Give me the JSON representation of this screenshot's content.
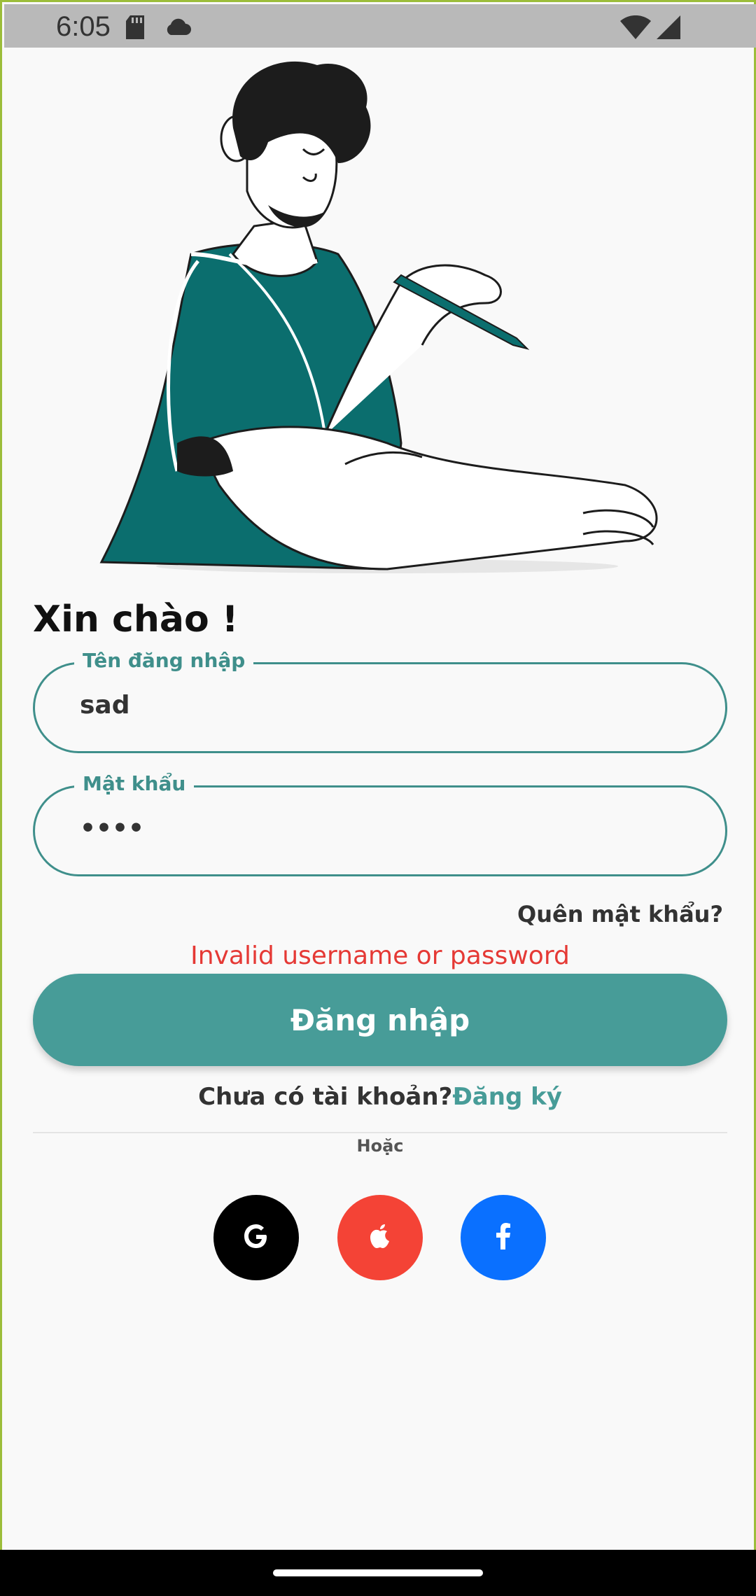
{
  "status_bar": {
    "time": "6:05",
    "icons": [
      "sd-card-icon",
      "cloud-icon",
      "wifi-icon",
      "signal-icon"
    ]
  },
  "illustration": {
    "name": "person-writing-illustration",
    "accent_color": "#0b6e6e"
  },
  "greeting": "Xin chào !",
  "username_field": {
    "label": "Tên đăng nhập",
    "value": "sad"
  },
  "password_field": {
    "label": "Mật khẩu",
    "value": "••••"
  },
  "forgot_password": "Quên mật khẩu?",
  "error_message": "Invalid username or password",
  "login_button": "Đăng nhập",
  "signup": {
    "prompt": "Chưa có tài khoản?",
    "link": "Đăng ký"
  },
  "or_divider": "Hoặc",
  "social_buttons": [
    {
      "name": "google",
      "icon": "google-icon",
      "color": "#000000"
    },
    {
      "name": "apple",
      "icon": "apple-icon",
      "color": "#f44336"
    },
    {
      "name": "facebook",
      "icon": "facebook-icon",
      "color": "#0a70ff"
    }
  ],
  "colors": {
    "primary": "#479c98",
    "field_border": "#3f8f8b",
    "error": "#e53935",
    "background": "#f9f9f9"
  }
}
